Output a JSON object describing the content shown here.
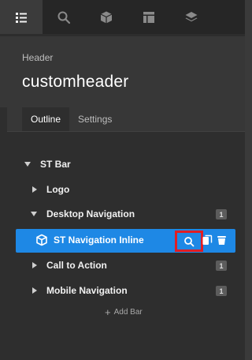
{
  "toolbar": {
    "tabs": [
      {
        "icon": "list-icon",
        "active": true
      },
      {
        "icon": "search-icon",
        "active": false
      },
      {
        "icon": "cube-icon",
        "active": false
      },
      {
        "icon": "layout-icon",
        "active": false
      },
      {
        "icon": "layers-icon",
        "active": false
      }
    ]
  },
  "panel": {
    "type_label": "Header",
    "title": "customheader"
  },
  "tabs": {
    "outline": "Outline",
    "settings": "Settings"
  },
  "outline": {
    "root": {
      "label": "ST Bar",
      "expanded": true
    },
    "items": [
      {
        "label": "Logo",
        "expanded": false,
        "badge": ""
      },
      {
        "label": "Desktop Navigation",
        "expanded": true,
        "badge": "1"
      },
      {
        "label": "ST Navigation Inline",
        "selected": true,
        "icon": "cube-icon"
      },
      {
        "label": "Call to Action",
        "expanded": false,
        "badge": "1"
      },
      {
        "label": "Mobile Navigation",
        "expanded": false,
        "badge": "1"
      }
    ],
    "add_bar": "Add Bar"
  },
  "colors": {
    "selected_row": "#1e88e5",
    "highlight_box": "#e01d24",
    "topbar": "#262626",
    "outline_bg": "#2e2e2e"
  }
}
